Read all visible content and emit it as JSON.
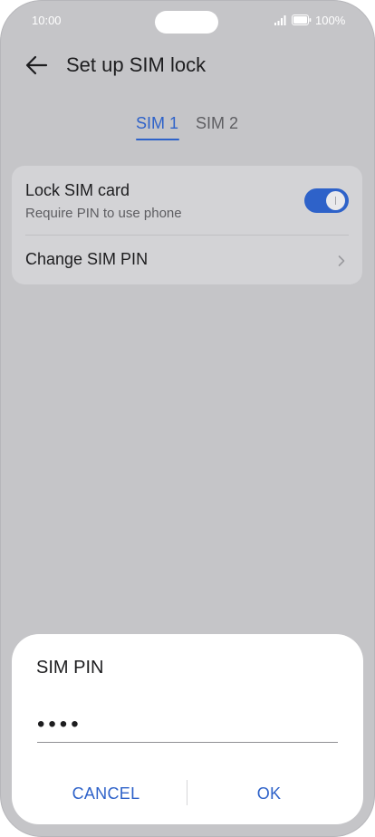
{
  "status_bar": {
    "time": "10:00",
    "battery_text": "100%"
  },
  "header": {
    "title": "Set up SIM lock",
    "back_icon": "arrow-left-icon"
  },
  "tabs": [
    {
      "label": "SIM 1",
      "selected": true
    },
    {
      "label": "SIM 2",
      "selected": false
    }
  ],
  "settings": {
    "lock_sim": {
      "title": "Lock SIM card",
      "subtitle": "Require PIN to use phone",
      "enabled": true
    },
    "change_pin": {
      "title": "Change SIM PIN"
    }
  },
  "dialog": {
    "title": "SIM PIN",
    "pin_value": "••••",
    "cancel_label": "CANCEL",
    "ok_label": "OK"
  },
  "colors": {
    "accent": "#2e62c9",
    "background": "#c5c5c8",
    "card": "#d3d3d6",
    "dialog": "#ffffff"
  }
}
